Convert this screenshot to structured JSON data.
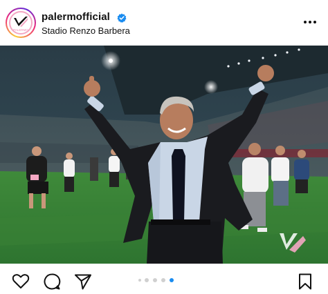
{
  "post": {
    "username": "palermofficial",
    "location": "Stadio Renzo Barbera",
    "verified": true,
    "avatar_brand_text": "PALERMO",
    "carousel": {
      "total": 4,
      "active_index": 4
    }
  },
  "icons": {
    "more": "more-horizontal-icon",
    "like": "heart-icon",
    "comment": "comment-bubble-icon",
    "share": "paper-plane-icon",
    "save": "bookmark-icon",
    "verified": "verified-badge-icon"
  },
  "colors": {
    "brand_pink": "#f4a7c3",
    "verified_blue": "#1a8cf0",
    "carousel_active": "#1a8cf0",
    "carousel_inactive": "#d0d0d0"
  }
}
